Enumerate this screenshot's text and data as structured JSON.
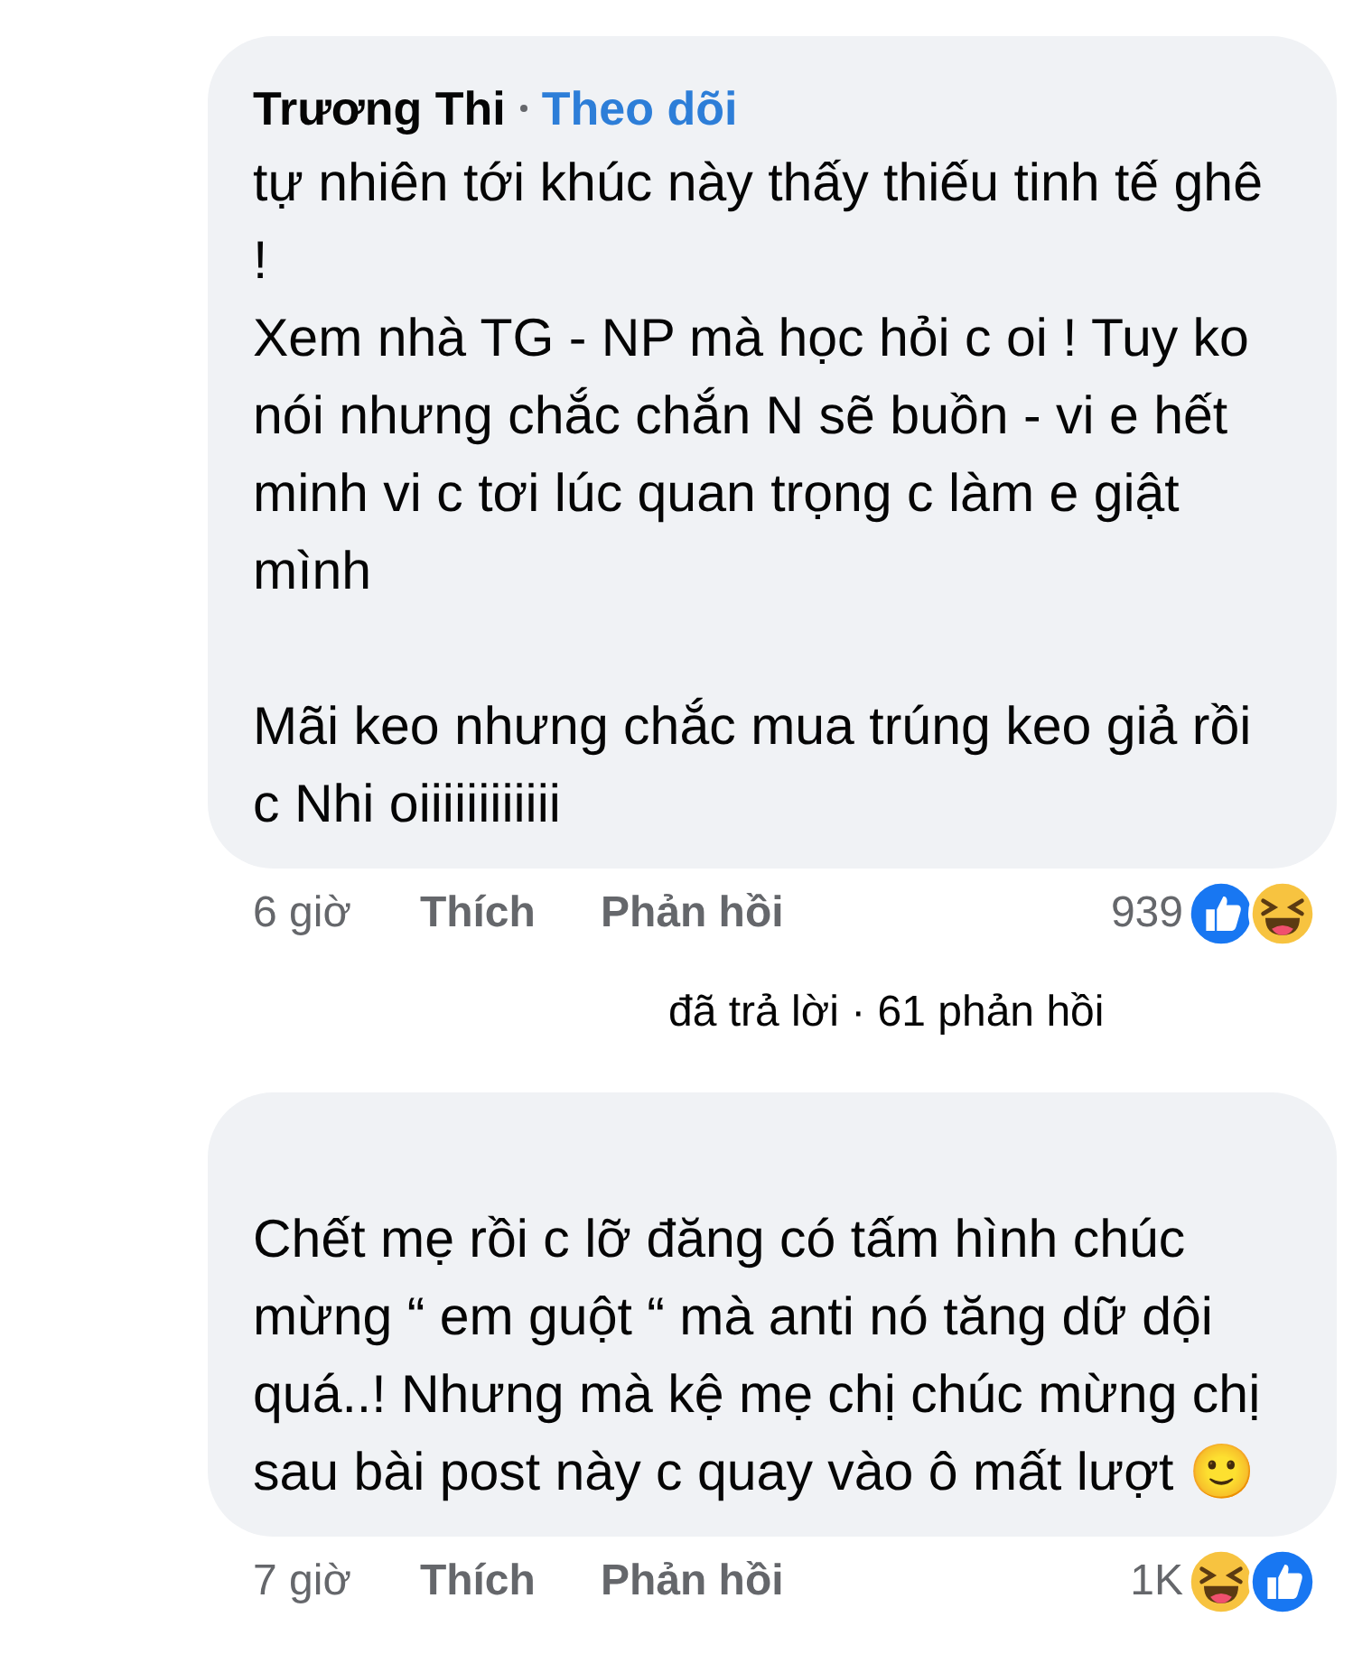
{
  "comments": [
    {
      "author": "Trương Thi",
      "follow": "Theo dõi",
      "body": "tự nhiên tới khúc này thấy thiếu tinh tế ghê !\nXem nhà TG - NP mà học hỏi c oi ! Tuy ko nói nhưng chắc chắn N sẽ buồn - vi e hết minh vi c tơi lúc quan trọng c làm e giật mình\n\nMãi keo nhưng chắc mua trúng keo giả rồi c Nhi oiiiiiiiiiiii",
      "time": "6 giờ",
      "like": "Thích",
      "reply": "Phản hồi",
      "count": "939",
      "reactions": [
        {
          "kind": "like"
        },
        {
          "kind": "haha"
        }
      ],
      "replies": "đã trả lời · 61 phản hồi"
    },
    {
      "body": "Chết mẹ rồi c lỡ đăng có tấm hình chúc mừng “ em guột “ mà anti nó tăng dữ dội quá..! Nhưng mà kệ mẹ chị chúc mừng chị sau bài post này c quay vào ô mất lượt 🙂",
      "time": "7 giờ",
      "like": "Thích",
      "reply": "Phản hồi",
      "count": "1K",
      "reactions": [
        {
          "kind": "haha"
        },
        {
          "kind": "like"
        }
      ]
    }
  ]
}
